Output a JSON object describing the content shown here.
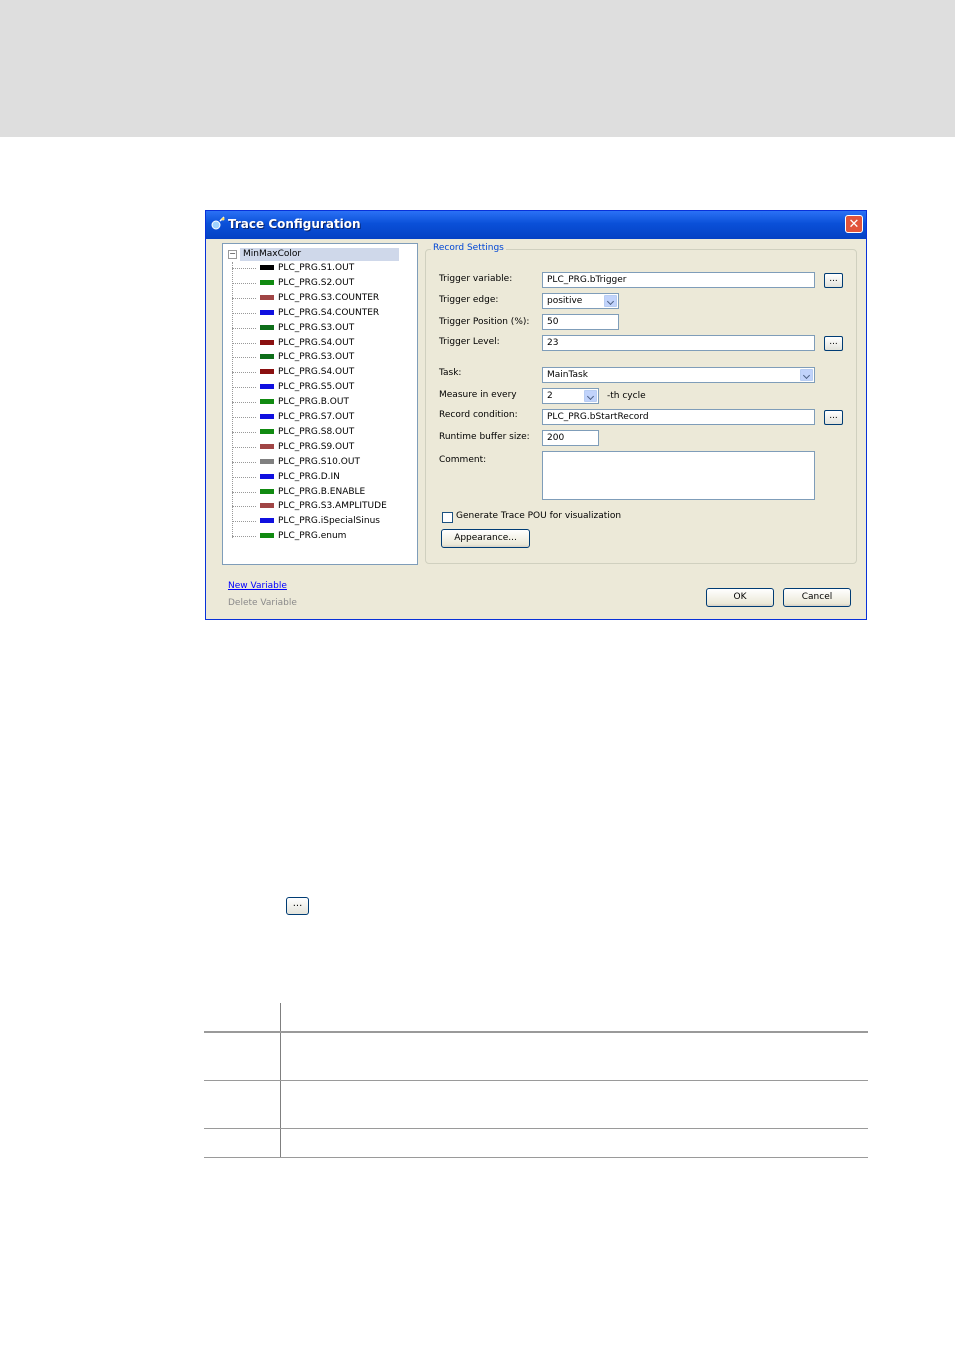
{
  "dialog": {
    "title": "Trace Configuration",
    "close_glyph": "✕"
  },
  "tree": {
    "root_label": "MinMaxColor",
    "expander_glyph": "−",
    "items": [
      {
        "label": "PLC_PRG.S1.OUT",
        "color": "#000000"
      },
      {
        "label": "PLC_PRG.S2.OUT",
        "color": "#118a11"
      },
      {
        "label": "PLC_PRG.S3.COUNTER",
        "color": "#a04545"
      },
      {
        "label": "PLC_PRG.S4.COUNTER",
        "color": "#1010e0"
      },
      {
        "label": "PLC_PRG.S3.OUT",
        "color": "#0e6e1a"
      },
      {
        "label": "PLC_PRG.S4.OUT",
        "color": "#8a1010"
      },
      {
        "label": "PLC_PRG.S3.OUT",
        "color": "#0e6e1a"
      },
      {
        "label": "PLC_PRG.S4.OUT",
        "color": "#8a1010"
      },
      {
        "label": "PLC_PRG.S5.OUT",
        "color": "#1010e0"
      },
      {
        "label": "PLC_PRG.B.OUT",
        "color": "#118a11"
      },
      {
        "label": "PLC_PRG.S7.OUT",
        "color": "#1010e0"
      },
      {
        "label": "PLC_PRG.S8.OUT",
        "color": "#118a11"
      },
      {
        "label": "PLC_PRG.S9.OUT",
        "color": "#a04545"
      },
      {
        "label": "PLC_PRG.S10.OUT",
        "color": "#808080"
      },
      {
        "label": "PLC_PRG.D.IN",
        "color": "#1010e0"
      },
      {
        "label": "PLC_PRG.B.ENABLE",
        "color": "#118a11"
      },
      {
        "label": "PLC_PRG.S3.AMPLITUDE",
        "color": "#a04545"
      },
      {
        "label": "PLC_PRG.iSpecialSinus",
        "color": "#1010e0"
      },
      {
        "label": "PLC_PRG.enum",
        "color": "#118a11"
      }
    ]
  },
  "record_settings": {
    "group_title": "Record Settings",
    "trigger_variable_label": "Trigger variable:",
    "trigger_variable_value": "PLC_PRG.bTrigger",
    "trigger_edge_label": "Trigger edge:",
    "trigger_edge_value": "positive",
    "trigger_position_label": "Trigger Position (%):",
    "trigger_position_value": "50",
    "trigger_level_label": "Trigger Level:",
    "trigger_level_value": "23",
    "task_label": "Task:",
    "task_value": "MainTask",
    "measure_label": "Measure in every",
    "measure_value": "2",
    "measure_suffix": "-th cycle",
    "record_condition_label": "Record condition:",
    "record_condition_value": "PLC_PRG.bStartRecord",
    "buffer_label": "Runtime buffer size:",
    "buffer_value": "200",
    "comment_label": "Comment:",
    "comment_value": "",
    "generate_checkbox_label": "Generate Trace POU for visualization",
    "appearance_button": "Appearance...",
    "browse_button": "..."
  },
  "footer": {
    "new_variable": "New Variable",
    "delete_variable": "Delete Variable",
    "ok_button": "OK",
    "cancel_button": "Cancel"
  },
  "standalone_button": "..."
}
